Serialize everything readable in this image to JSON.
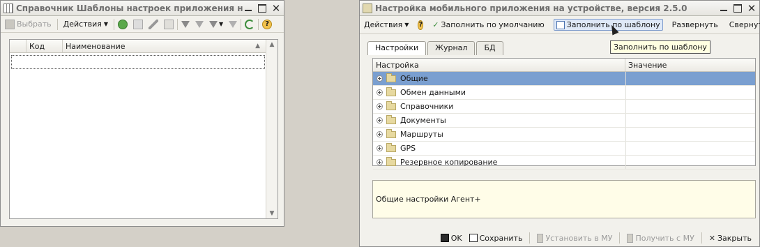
{
  "left_window": {
    "title": "Справочник Шаблоны настроек приложения на МУ",
    "toolbar": {
      "select_label": "Выбрать",
      "actions_label": "Действия"
    },
    "table": {
      "col_code": "Код",
      "col_name": "Наименование"
    }
  },
  "right_window": {
    "title": "Настройка мобильного приложения на устройстве, версия 2.5.0",
    "toolbar": {
      "actions_label": "Действия",
      "fill_default_label": "Заполнить по умолчанию",
      "fill_template_label": "Заполнить по шаблону",
      "expand_label": "Развернуть",
      "collapse_label": "Свернуть"
    },
    "tooltip": "Заполнить по шаблону",
    "tabs": [
      "Настройки",
      "Журнал",
      "БД"
    ],
    "grid": {
      "col_setting": "Настройка",
      "col_value": "Значение",
      "rows": [
        "Общие",
        "Обмен данными",
        "Справочники",
        "Документы",
        "Маршруты",
        "GPS",
        "Резервное копирование"
      ]
    },
    "description": "Общие настройки Агент+",
    "bottom": {
      "ok_label": "OK",
      "save_label": "Сохранить",
      "install_label": "Установить в МУ",
      "get_label": "Получить с МУ",
      "close_label": "Закрыть"
    }
  },
  "colors": {
    "selection": "#7a9fd0",
    "window_bg": "#f2f1ec",
    "desktop_bg": "#d4d0c8"
  }
}
